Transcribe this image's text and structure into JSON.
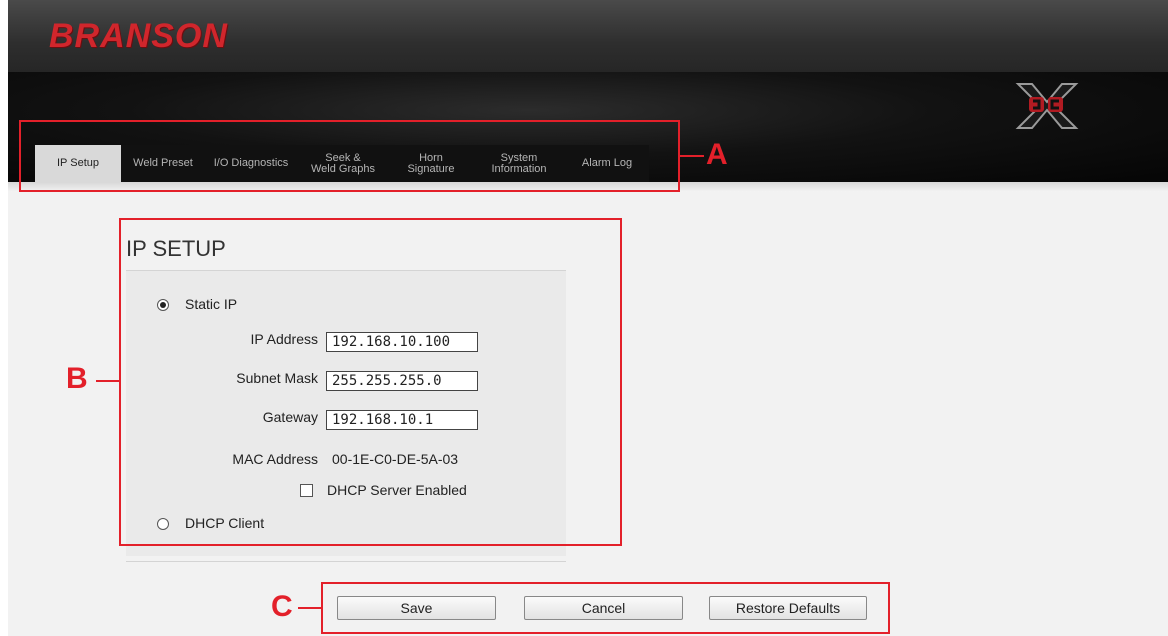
{
  "header": {
    "brand": "BRANSON"
  },
  "tabs": [
    {
      "label": "IP Setup",
      "active": true
    },
    {
      "label": "Weld Preset",
      "active": false
    },
    {
      "label": "I/O Diagnostics",
      "active": false
    },
    {
      "label": "Seek &\nWeld Graphs",
      "active": false
    },
    {
      "label": "Horn\nSignature",
      "active": false
    },
    {
      "label": "System\nInformation",
      "active": false
    },
    {
      "label": "Alarm Log",
      "active": false
    }
  ],
  "ip_setup": {
    "title": "IP SETUP",
    "static_ip_label": "Static IP",
    "static_ip_selected": true,
    "ip_address_label": "IP Address",
    "ip_address_value": "192.168.10.100",
    "subnet_mask_label": "Subnet Mask",
    "subnet_mask_value": "255.255.255.0",
    "gateway_label": "Gateway",
    "gateway_value": "192.168.10.1",
    "mac_address_label": "MAC Address",
    "mac_address_value": "00-1E-C0-DE-5A-03",
    "dhcp_server_label": "DHCP Server Enabled",
    "dhcp_server_enabled": false,
    "dhcp_client_label": "DHCP Client",
    "dhcp_client_selected": false
  },
  "buttons": {
    "save": "Save",
    "cancel": "Cancel",
    "restore": "Restore Defaults"
  },
  "annotations": {
    "a": "A",
    "b": "B",
    "c": "C"
  },
  "colors": {
    "brand_red": "#d0262c",
    "callout_red": "#e3202a"
  }
}
